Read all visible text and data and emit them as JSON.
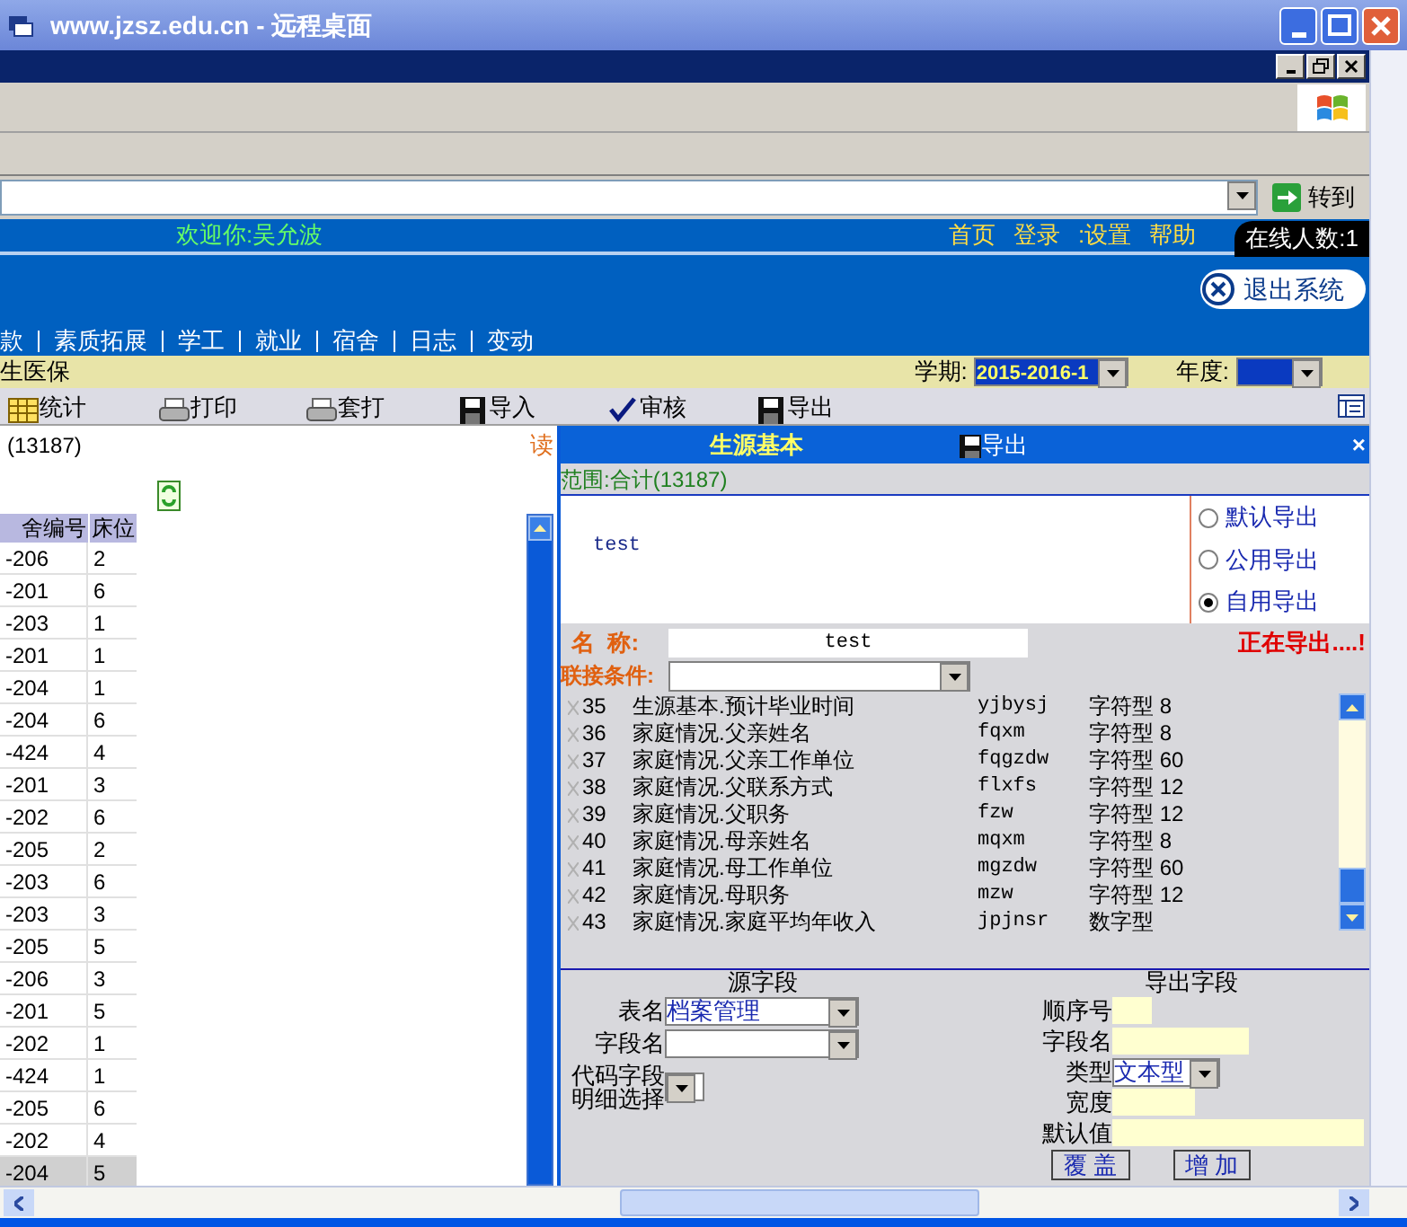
{
  "window": {
    "title": "www.jzsz.edu.cn - 远程桌面"
  },
  "address_bar": {
    "go_button": "转到"
  },
  "header": {
    "welcome": "欢迎你:吴允波",
    "links": [
      "首页",
      "登录",
      ":设置",
      "帮助"
    ],
    "online": "在线人数:1",
    "logout": "退出系统"
  },
  "nav": {
    "items": [
      "款",
      "素质拓展",
      "学工",
      "就业",
      "宿舍",
      "日志",
      "变动"
    ]
  },
  "subbar": {
    "title": "生医保",
    "term_label": "学期:",
    "term_value": "2015-2016-1",
    "year_label": "年度:"
  },
  "toolbar": [
    {
      "label": "统计",
      "kind": "grid"
    },
    {
      "label": "打印",
      "kind": "printer"
    },
    {
      "label": "套打",
      "kind": "printer"
    },
    {
      "label": "导入",
      "kind": "disk"
    },
    {
      "label": "审核",
      "kind": "check"
    },
    {
      "label": "导出",
      "kind": "disk"
    }
  ],
  "left_pane": {
    "count": "(13187)",
    "read": "读",
    "columns": [
      "舍编号",
      "床位"
    ],
    "rows": [
      {
        "room": "-206",
        "bed": "2",
        "selected": false
      },
      {
        "room": "-201",
        "bed": "6",
        "selected": false
      },
      {
        "room": "-203",
        "bed": "1",
        "selected": false
      },
      {
        "room": "-201",
        "bed": "1",
        "selected": false
      },
      {
        "room": "-204",
        "bed": "1",
        "selected": false
      },
      {
        "room": "-204",
        "bed": "6",
        "selected": false
      },
      {
        "room": "-424",
        "bed": "4",
        "selected": false
      },
      {
        "room": "-201",
        "bed": "3",
        "selected": false
      },
      {
        "room": "-202",
        "bed": "6",
        "selected": false
      },
      {
        "room": "-205",
        "bed": "2",
        "selected": false
      },
      {
        "room": "-203",
        "bed": "6",
        "selected": false
      },
      {
        "room": "-203",
        "bed": "3",
        "selected": false
      },
      {
        "room": "-205",
        "bed": "5",
        "selected": false
      },
      {
        "room": "-206",
        "bed": "3",
        "selected": false
      },
      {
        "room": "-201",
        "bed": "5",
        "selected": false
      },
      {
        "room": "-202",
        "bed": "1",
        "selected": false
      },
      {
        "room": "-424",
        "bed": "1",
        "selected": false
      },
      {
        "room": "-205",
        "bed": "6",
        "selected": false
      },
      {
        "room": "-202",
        "bed": "4",
        "selected": false
      },
      {
        "room": "-204",
        "bed": "5",
        "selected": true
      }
    ]
  },
  "export_panel": {
    "title": "生源基本",
    "export": "导出",
    "close": "×",
    "scope": "范围:合计(13187)",
    "preview": "test",
    "options": [
      {
        "label": "默认导出",
        "selected": false
      },
      {
        "label": "公用导出",
        "selected": false
      },
      {
        "label": "自用导出",
        "selected": true
      }
    ],
    "name_label": "名  称:",
    "name_value": "test",
    "status": "正在导出....!",
    "join_label": "联接条件:",
    "fields": [
      {
        "index": "35",
        "name": "生源基本.预计毕业时间",
        "code": "yjbysj",
        "type": "字符型 8"
      },
      {
        "index": "36",
        "name": "家庭情况.父亲姓名",
        "code": "fqxm",
        "type": "字符型 8"
      },
      {
        "index": "37",
        "name": "家庭情况.父亲工作单位",
        "code": "fqgzdw",
        "type": "字符型 60"
      },
      {
        "index": "38",
        "name": "家庭情况.父联系方式",
        "code": "flxfs",
        "type": "字符型 12"
      },
      {
        "index": "39",
        "name": "家庭情况.父职务",
        "code": "fzw",
        "type": "字符型 12"
      },
      {
        "index": "40",
        "name": "家庭情况.母亲姓名",
        "code": "mqxm",
        "type": "字符型 8"
      },
      {
        "index": "41",
        "name": "家庭情况.母工作单位",
        "code": "mgzdw",
        "type": "字符型 60"
      },
      {
        "index": "42",
        "name": "家庭情况.母职务",
        "code": "mzw",
        "type": "字符型 12"
      },
      {
        "index": "43",
        "name": "家庭情况.家庭平均年收入",
        "code": "jpjnsr",
        "type": "数字型"
      }
    ],
    "source": {
      "heading": "源字段",
      "table_label": "表名",
      "table_value": "档案管理",
      "field_label": "字段名",
      "code_label": [
        "代码字段",
        "明细选择"
      ]
    },
    "target": {
      "heading": "导出字段",
      "order_label": "顺序号",
      "name_label": "字段名",
      "type_label": "类型",
      "type_value": "文本型",
      "width_label": "宽度",
      "default_label": "默认值",
      "buttons": [
        "覆 盖",
        "增 加"
      ]
    }
  }
}
